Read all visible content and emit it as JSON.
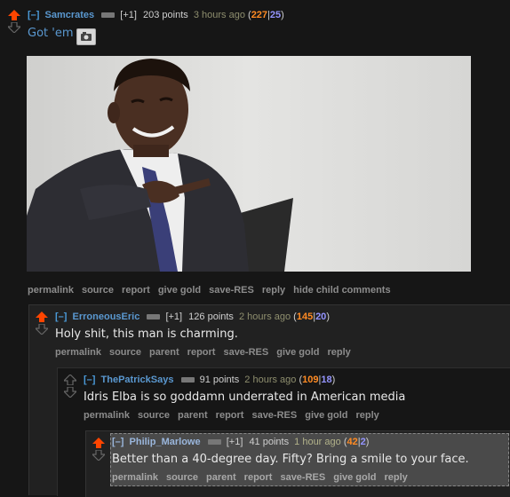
{
  "colors": {
    "upvote": "#ff4500",
    "username": "#5a98d0",
    "upvotes_count": "#ff8b24",
    "downvotes_count": "#9494ff"
  },
  "comments": [
    {
      "expand": "[–]",
      "author": "Samcrates",
      "vote_tag": "[+1]",
      "score": "203 points",
      "time": "3 hours ago",
      "ups": "227",
      "downs": "25",
      "body": "Got 'em",
      "image_icon": "camera-icon",
      "buttons": [
        "permalink",
        "source",
        "report",
        "give gold",
        "save-RES",
        "reply",
        "hide child comments"
      ]
    },
    {
      "expand": "[–]",
      "author": "ErroneousEric",
      "vote_tag": "[+1]",
      "score": "126 points",
      "time": "2 hours ago",
      "ups": "145",
      "downs": "20",
      "body": "Holy shit, this man is charming.",
      "buttons": [
        "permalink",
        "source",
        "parent",
        "report",
        "save-RES",
        "give gold",
        "reply"
      ]
    },
    {
      "expand": "[–]",
      "author": "ThePatrickSays",
      "score": "91 points",
      "time": "2 hours ago",
      "ups": "109",
      "downs": "18",
      "body": "Idris Elba is so goddamn underrated in American media",
      "buttons": [
        "permalink",
        "source",
        "parent",
        "report",
        "save-RES",
        "give gold",
        "reply"
      ]
    },
    {
      "expand": "[–]",
      "author": "Philip_Marlowe",
      "vote_tag": "[+1]",
      "score": "41 points",
      "time": "1 hour ago",
      "ups": "42",
      "downs": "2",
      "body": "Better than a 40-degree day. Fifty? Bring a smile to your face.",
      "buttons": [
        "permalink",
        "source",
        "parent",
        "report",
        "save-RES",
        "give gold",
        "reply"
      ]
    }
  ]
}
